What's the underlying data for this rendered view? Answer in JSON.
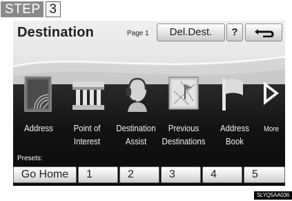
{
  "step": {
    "word": "STEP",
    "number": "3"
  },
  "header": {
    "title": "Destination",
    "page": "Page 1",
    "del_dest": "Del.Dest.",
    "help": "?"
  },
  "menu": [
    {
      "line1": "Address",
      "line2": "",
      "icon": "address-map-icon"
    },
    {
      "line1": "Point of",
      "line2": "Interest",
      "icon": "building-columns-icon"
    },
    {
      "line1": "Destination",
      "line2": "Assist",
      "icon": "operator-headset-icon"
    },
    {
      "line1": "Previous",
      "line2": "Destinations",
      "icon": "flag-on-map-icon"
    },
    {
      "line1": "Address",
      "line2": "Book",
      "icon": "flag-icon"
    },
    {
      "line1": "More",
      "line2": "",
      "icon": "triangle-right-icon"
    }
  ],
  "presets": {
    "label": "Presets:",
    "home": "Go Home",
    "slots": [
      "1",
      "2",
      "3",
      "4",
      "5"
    ]
  },
  "image_code": "SLYQ5AA036",
  "colors": {
    "screen_top": "#e6e6e6",
    "screen_bottom": "#0f0f0f",
    "step_tag": "#8a8a8a"
  }
}
